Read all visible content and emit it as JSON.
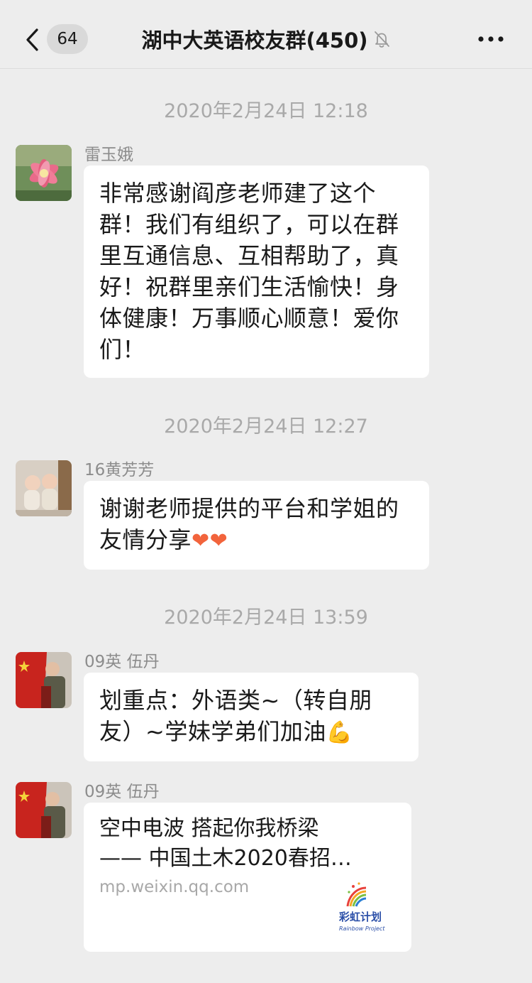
{
  "header": {
    "unread_count": "64",
    "title": "湖中大英语校友群(450)"
  },
  "messages": [
    {
      "time": "2020年2月24日 12:18",
      "sender": "雷玉娥",
      "text": "非常感谢阎彦老师建了这个群！我们有组织了，可以在群里互通信息、互相帮助了，真好！祝群里亲们生活愉快！身体健康！万事顺心顺意！爱你们！"
    },
    {
      "time": "2020年2月24日 12:27",
      "sender": "16黄芳芳",
      "text": "谢谢老师提供的平台和学姐的友情分享",
      "emoji": "❤❤"
    },
    {
      "time": "2020年2月24日 13:59",
      "sender": "09英 伍丹",
      "text": "划重点：外语类~（转自朋友）~学妹学弟们加油",
      "emoji": "💪"
    },
    {
      "sender": "09英 伍丹",
      "link": {
        "title": "空中电波 搭起你我桥梁\n—— 中国土木2020春招…",
        "domain": "mp.weixin.qq.com",
        "thumb_brand": "彩虹计划",
        "thumb_sub": "Rainbow Project"
      }
    }
  ],
  "icons": {
    "back": "chevron-left-icon",
    "mute": "bell-off-icon",
    "more": "ellipsis-icon"
  },
  "colors": {
    "background": "#ededed",
    "bubble": "#ffffff",
    "timestamp": "#a9a9a9",
    "sender": "#8c8c8c",
    "emoji_heart": "#f2643c",
    "emoji_arm": "#f2b53a"
  }
}
